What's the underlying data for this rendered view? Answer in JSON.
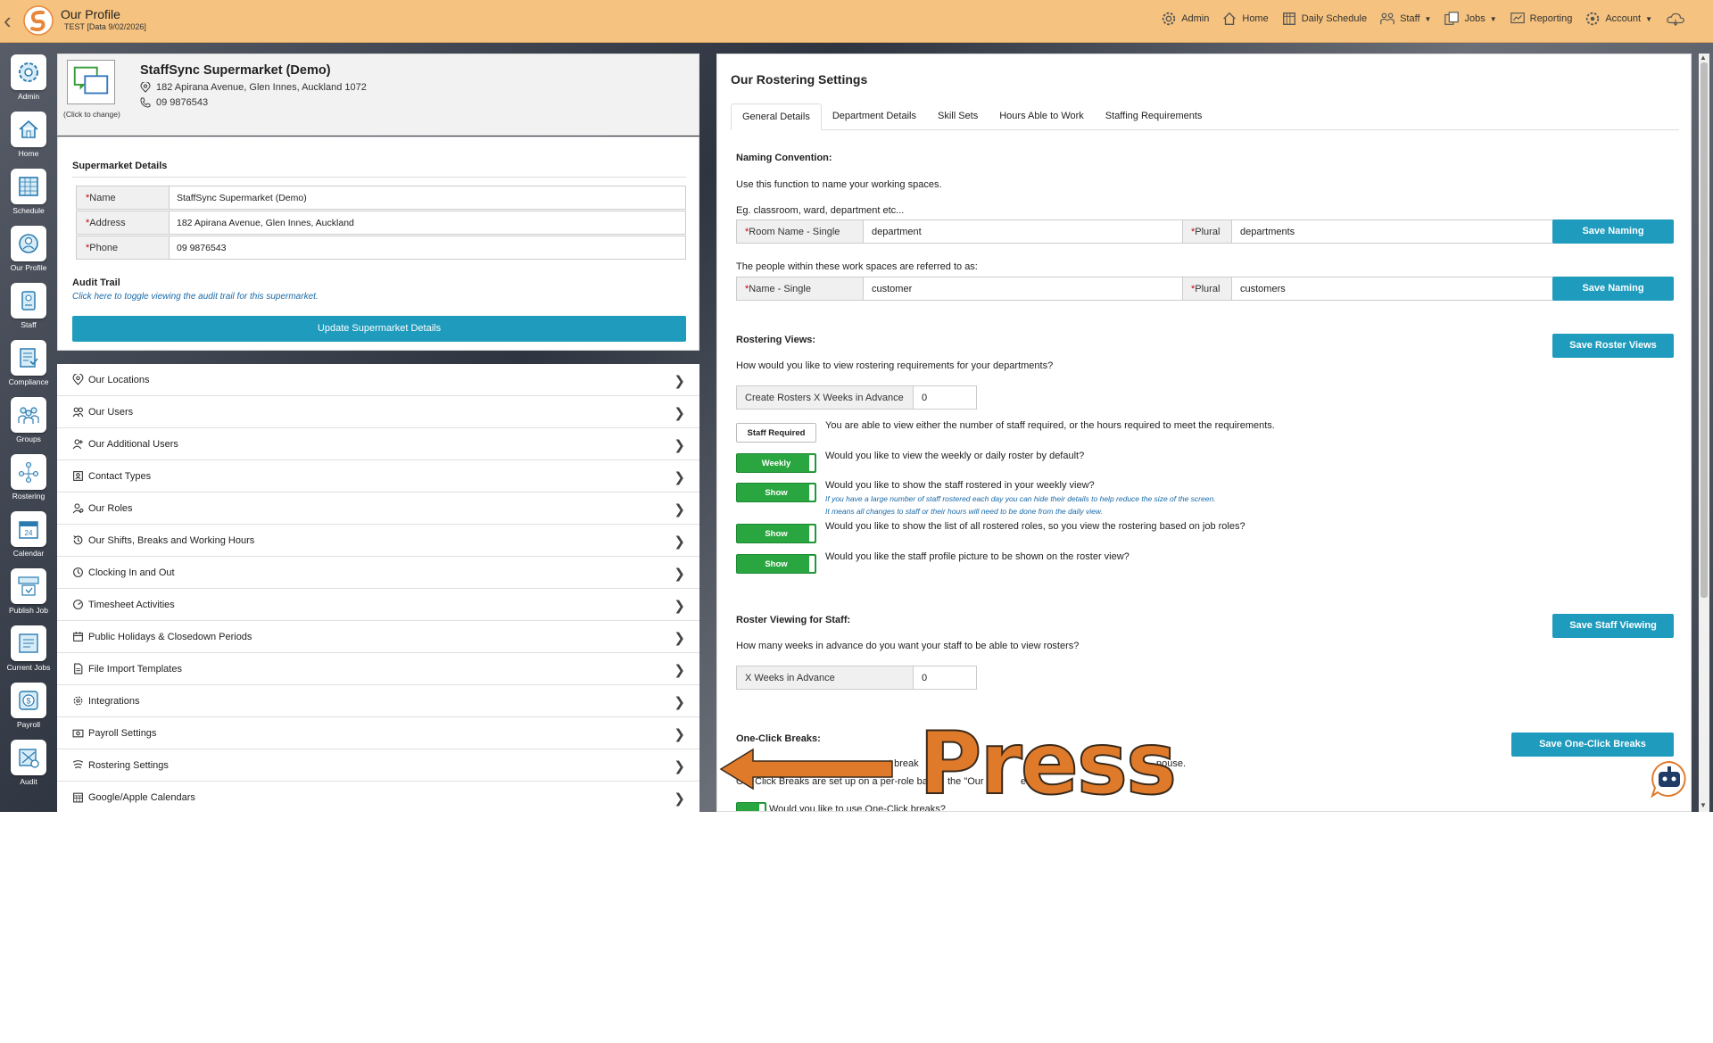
{
  "header": {
    "title": "Our Profile",
    "subtitle": "TEST [Data 9/02/2026]",
    "nav": [
      {
        "label": "Admin",
        "icon": "gear-icon"
      },
      {
        "label": "Home",
        "icon": "home-icon"
      },
      {
        "label": "Daily Schedule",
        "icon": "schedule-icon"
      },
      {
        "label": "Staff",
        "icon": "staff-icon",
        "dropdown": true
      },
      {
        "label": "Jobs",
        "icon": "jobs-icon",
        "dropdown": true
      },
      {
        "label": "Reporting",
        "icon": "reporting-icon"
      },
      {
        "label": "Account",
        "icon": "account-icon",
        "dropdown": true
      }
    ]
  },
  "sidebar": {
    "items": [
      {
        "label": "Admin",
        "icon": "gear-icon"
      },
      {
        "label": "Home",
        "icon": "home-icon"
      },
      {
        "label": "Schedule",
        "icon": "schedule-icon"
      },
      {
        "label": "Our Profile",
        "icon": "profile-icon"
      },
      {
        "label": "Staff",
        "icon": "staff-icon"
      },
      {
        "label": "Compliance",
        "icon": "compliance-icon"
      },
      {
        "label": "Groups",
        "icon": "groups-icon"
      },
      {
        "label": "Rostering",
        "icon": "rostering-icon"
      },
      {
        "label": "Calendar",
        "icon": "calendar-icon"
      },
      {
        "label": "Publish Job",
        "icon": "publish-job-icon"
      },
      {
        "label": "Current Jobs",
        "icon": "current-jobs-icon"
      },
      {
        "label": "Payroll",
        "icon": "payroll-icon"
      },
      {
        "label": "Audit",
        "icon": "audit-icon"
      }
    ]
  },
  "profile": {
    "name": "StaffSync Supermarket (Demo)",
    "address": "182 Apirana Avenue, Glen Innes, Auckland 1072",
    "phone": "09 9876543",
    "logo_caption": "(Click to change)"
  },
  "details": {
    "section_title": "Supermarket Details",
    "fields": [
      {
        "label": "Name",
        "value": "StaffSync Supermarket (Demo)"
      },
      {
        "label": "Address",
        "value": "182 Apirana Avenue, Glen Innes, Auckland"
      },
      {
        "label": "Phone",
        "value": "09 9876543"
      }
    ],
    "required_mark": "*",
    "audit_title": "Audit Trail",
    "audit_link": "Click here to toggle viewing the audit trail for this supermarket.",
    "update_button": "Update Supermarket Details"
  },
  "menu": {
    "items": [
      {
        "label": "Our Locations",
        "icon": "location-pin-icon"
      },
      {
        "label": "Our Users",
        "icon": "users-icon"
      },
      {
        "label": "Our Additional Users",
        "icon": "user-add-icon"
      },
      {
        "label": "Contact Types",
        "icon": "contact-card-icon"
      },
      {
        "label": "Our Roles",
        "icon": "roles-icon"
      },
      {
        "label": "Our Shifts, Breaks and Working Hours",
        "icon": "clock-refresh-icon"
      },
      {
        "label": "Clocking In and Out",
        "icon": "clock-icon"
      },
      {
        "label": "Timesheet Activities",
        "icon": "timer-icon"
      },
      {
        "label": "Public Holidays & Closedown Periods",
        "icon": "holiday-icon"
      },
      {
        "label": "File Import Templates",
        "icon": "file-icon"
      },
      {
        "label": "Integrations",
        "icon": "integrations-icon"
      },
      {
        "label": "Payroll Settings",
        "icon": "payroll-icon"
      },
      {
        "label": "Rostering Settings",
        "icon": "rostering-icon"
      },
      {
        "label": "Google/Apple Calendars",
        "icon": "calendar-icon"
      }
    ]
  },
  "rostering": {
    "title": "Our Rostering Settings",
    "tabs": [
      "General Details",
      "Department Details",
      "Skill Sets",
      "Hours Able to Work",
      "Staffing Requirements"
    ],
    "naming": {
      "heading": "Naming Convention:",
      "desc1": "Use this function to name your working spaces.",
      "desc2": "Eg. classroom, ward, department etc...",
      "room_label": "Room Name - Single",
      "room_value": "department",
      "plural_label": "Plural",
      "room_plural_value": "departments",
      "save_button": "Save Naming",
      "people_desc": "The people within these work spaces are referred to as:",
      "name_label": "Name - Single",
      "name_value": "customer",
      "name_plural_value": "customers"
    },
    "views": {
      "heading": "Rostering Views:",
      "save_button": "Save Roster Views",
      "question": "How would you like to view rostering requirements for your departments?",
      "weeks_label": "Create Rosters X Weeks in Advance",
      "weeks_value": "0",
      "staff_required_toggle": "Staff Required",
      "staff_required_text": "You are able to view either the number of staff required, or the hours required to meet the requirements.",
      "weekly_toggle": "Weekly",
      "weekly_text": "Would you like to view the weekly or daily roster by default?",
      "show_toggle": "Show",
      "show_staff_text": "Would you like to show the staff rostered in your weekly view?",
      "show_staff_note1": "If you have a large number of staff rostered each day you can hide their details to help reduce the size of the screen.",
      "show_staff_note2": "It means all changes to staff or their hours will need to be done from the daily view.",
      "show_roles_text": "Would you like to show the list of all rostered roles, so you view the rostering based on job roles?",
      "show_picture_text": "Would you like the staff profile picture to be shown on the roster view?"
    },
    "staff_view": {
      "heading": "Roster Viewing for Staff:",
      "save_button": "Save Staff Viewing",
      "question": "How many weeks in advance do you want your staff to be able to view rosters?",
      "weeks_label": "X Weeks in Advance",
      "weeks_value": "0"
    },
    "breaks": {
      "heading": "One-Click Breaks:",
      "save_button": "Save One-Click Breaks",
      "line1_visible": "t break",
      "line1_end": "nouse.",
      "line2_start": "O",
      "line2_mid": "Click Breaks are set up on a per-role ba",
      "line2_mid2": "the \"Our",
      "line2_end": "es\"",
      "line3": "Would you like to use One-Click breaks?"
    }
  },
  "annotation": {
    "text": "Press",
    "color": "#e07a2b"
  },
  "colors": {
    "header_bg": "#f5c27f",
    "primary_button": "#1e9bbd",
    "toggle_green": "#2aa640"
  }
}
